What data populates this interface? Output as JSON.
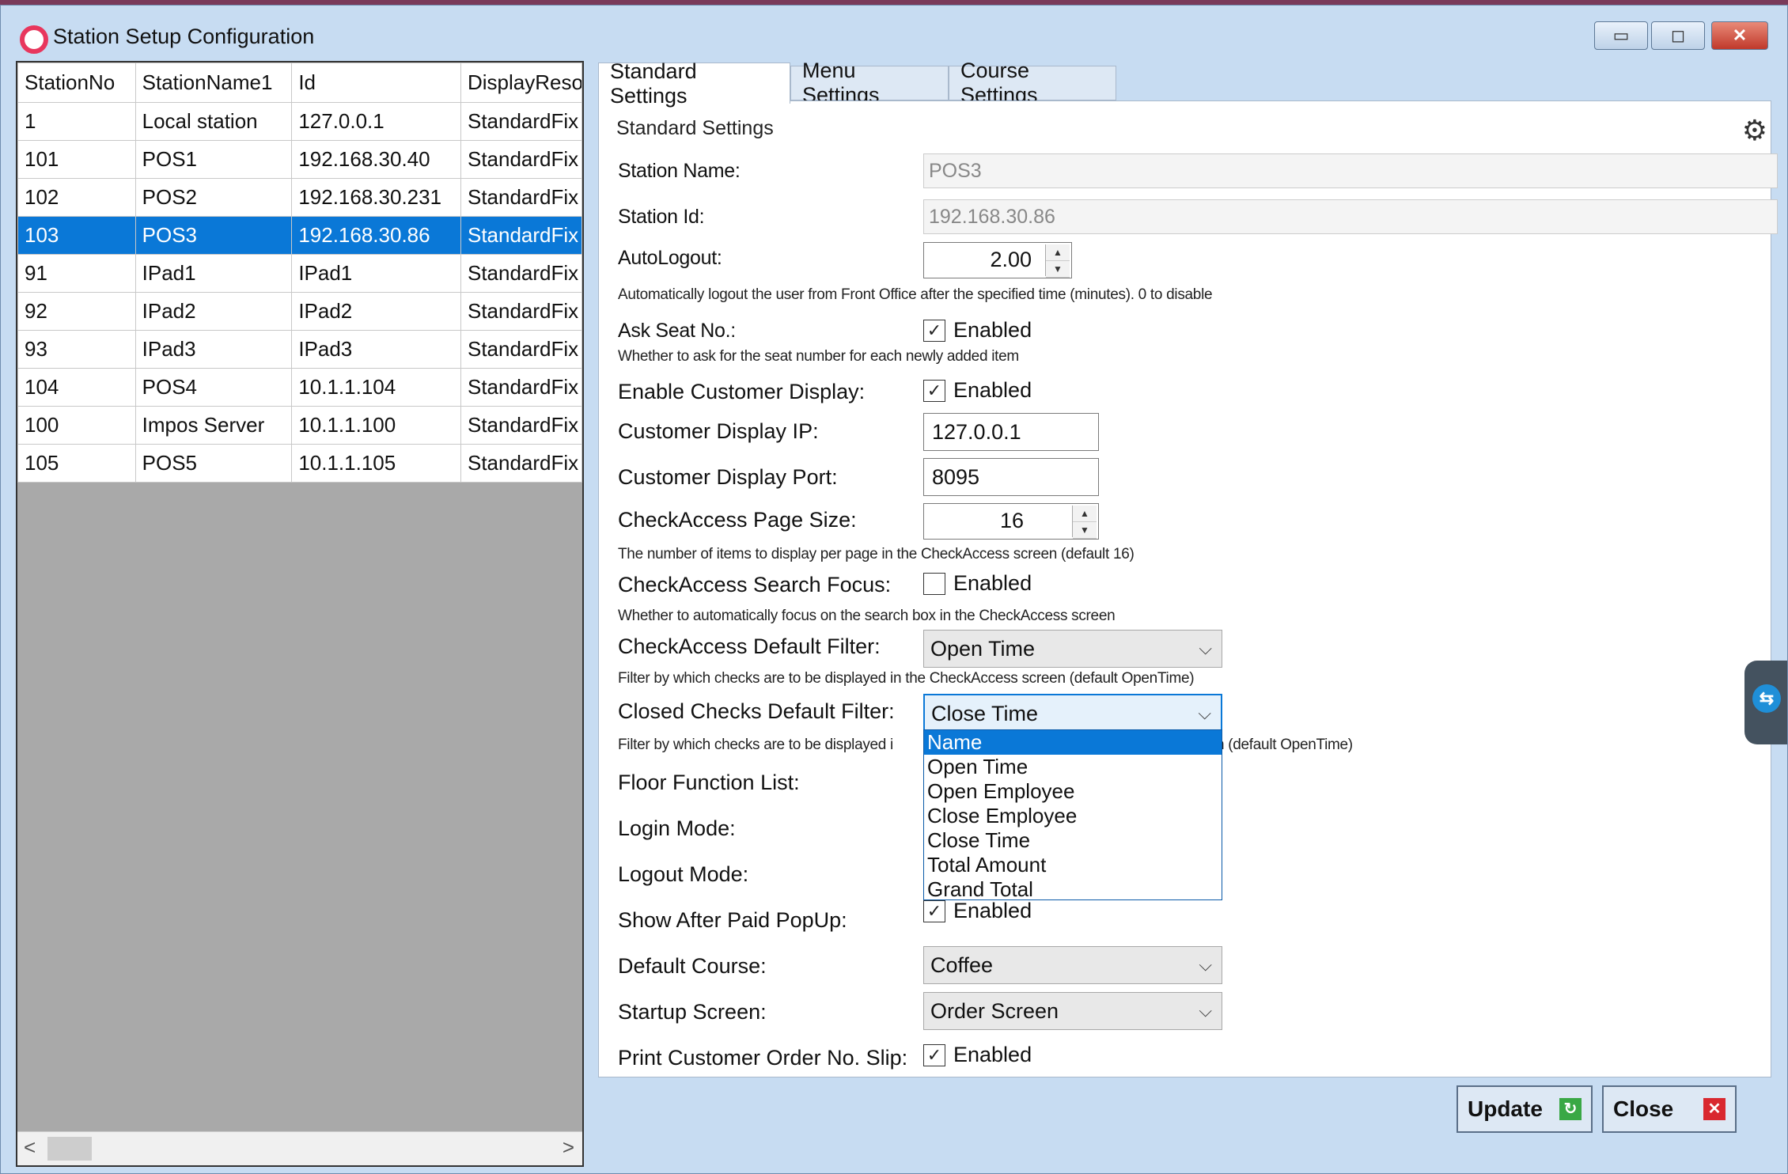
{
  "window": {
    "title": "Station Setup Configuration",
    "controls": {
      "minimize": "▭",
      "maximize": "◻",
      "close": "✕"
    }
  },
  "grid": {
    "columns": [
      "StationNo",
      "StationName1",
      "Id",
      "DisplayReso"
    ],
    "rows": [
      [
        "1",
        "Local station",
        "127.0.0.1",
        "StandardFix"
      ],
      [
        "101",
        "POS1",
        "192.168.30.40",
        "StandardFix"
      ],
      [
        "102",
        "POS2",
        "192.168.30.231",
        "StandardFix"
      ],
      [
        "103",
        "POS3",
        "192.168.30.86",
        "StandardFix"
      ],
      [
        "91",
        "IPad1",
        "IPad1",
        "StandardFix"
      ],
      [
        "92",
        "IPad2",
        "IPad2",
        "StandardFix"
      ],
      [
        "93",
        "IPad3",
        "IPad3",
        "StandardFix"
      ],
      [
        "104",
        "POS4",
        "10.1.1.104",
        "StandardFix"
      ],
      [
        "100",
        "Impos Server",
        "10.1.1.100",
        "StandardFix"
      ],
      [
        "105",
        "POS5",
        "10.1.1.105",
        "StandardFix"
      ]
    ],
    "selected_index": 3,
    "scroll_left": "<",
    "scroll_right": ">"
  },
  "tabs": [
    "Standard Settings",
    "Menu Settings",
    "Course Settings"
  ],
  "panel": {
    "heading": "Standard Settings",
    "station_name": {
      "label": "Station Name:",
      "value": "POS3"
    },
    "station_id": {
      "label": "Station Id:",
      "value": "192.168.30.86"
    },
    "auto_logout": {
      "label": "AutoLogout:",
      "value": "2.00",
      "desc": "Automatically logout the user from Front Office after the specified time (minutes). 0 to disable"
    },
    "ask_seat": {
      "label": "Ask Seat No.:",
      "check": "Enabled",
      "checked": true,
      "desc": "Whether to ask for the seat number for each newly added item"
    },
    "customer_display": {
      "label": "Enable Customer Display:",
      "check": "Enabled",
      "checked": true
    },
    "customer_display_ip": {
      "label": "Customer Display IP:",
      "value": "127.0.0.1"
    },
    "customer_display_port": {
      "label": "Customer Display Port:",
      "value": "8095"
    },
    "page_size": {
      "label": "CheckAccess Page Size:",
      "value": "16",
      "desc": "The number of items to display per page in the CheckAccess screen (default 16)"
    },
    "search_focus": {
      "label": "CheckAccess Search Focus:",
      "check": "Enabled",
      "checked": false,
      "desc": "Whether to automatically focus on the search box in the CheckAccess screen"
    },
    "default_filter": {
      "label": "CheckAccess Default Filter:",
      "value": "Open Time",
      "desc": "Filter by which checks are to be displayed in the CheckAccess screen (default OpenTime)"
    },
    "closed_filter": {
      "label": "Closed Checks Default Filter:",
      "value": "Close Time",
      "desc_left": "Filter by which checks are to be displayed i",
      "desc_right": "n (default OpenTime)",
      "options": [
        "Name",
        "Open Time",
        "Open Employee",
        "Close Employee",
        "Close Time",
        "Total Amount",
        "Grand Total"
      ],
      "highlighted": 0
    },
    "floor_function": {
      "label": "Floor Function List:"
    },
    "login_mode": {
      "label": "Login Mode:"
    },
    "logout_mode": {
      "label": "Logout Mode:"
    },
    "after_paid": {
      "label": "Show After Paid PopUp:",
      "check": "Enabled",
      "checked": true
    },
    "default_course": {
      "label": "Default Course:",
      "value": "Coffee"
    },
    "startup_screen": {
      "label": "Startup Screen:",
      "value": "Order Screen"
    },
    "print_slip": {
      "label": "Print Customer Order No. Slip:",
      "check": "Enabled",
      "checked": true
    }
  },
  "buttons": {
    "update": "Update",
    "close": "Close"
  },
  "icons": {
    "checkmark": "✓",
    "chevron": "⌵",
    "gear": "⚙",
    "refresh": "↻",
    "close_x": "✕"
  },
  "colors": {
    "selection": "#0a78d7",
    "window_frame": "#c7dcf2",
    "close_red": "#d9282f",
    "update_green": "#3aa845"
  }
}
